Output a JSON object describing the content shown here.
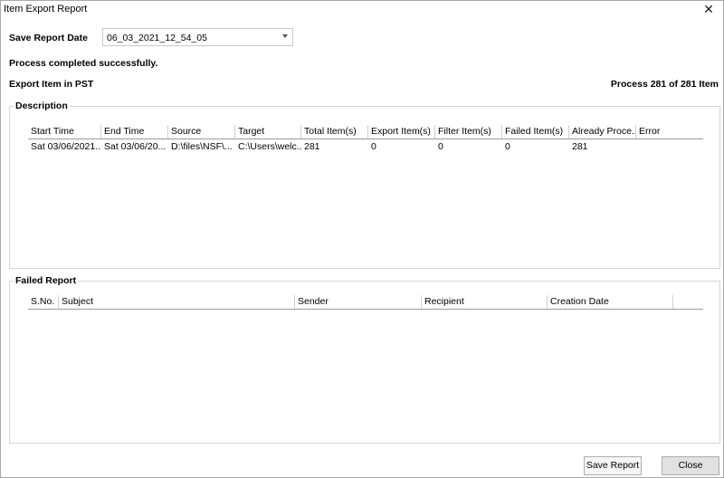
{
  "window": {
    "title": "Item Export Report",
    "close_glyph": "✕"
  },
  "header": {
    "save_report_date_label": "Save Report Date",
    "save_report_date_value": "06_03_2021_12_54_05",
    "status_message": "Process completed successfully.",
    "export_label": "Export Item in PST",
    "progress_text": "Process 281 of 281 Item"
  },
  "description": {
    "title": "Description",
    "columns": [
      "Start Time",
      "End Time",
      "Source",
      "Target",
      "Total Item(s)",
      "Export Item(s)",
      "Filter Item(s)",
      "Failed Item(s)",
      "Already Proce...",
      "Error"
    ],
    "rows": [
      [
        "Sat 03/06/2021...",
        "Sat 03/06/20...",
        "D:\\files\\NSF\\...",
        "C:\\Users\\welc...",
        "281",
        "0",
        "0",
        "0",
        "281",
        ""
      ]
    ]
  },
  "failed_report": {
    "title": "Failed Report",
    "columns": [
      "S.No.",
      "Subject",
      "Sender",
      "Recipient",
      "Creation Date"
    ]
  },
  "footer": {
    "save_report_label": "Save Report",
    "close_label": "Close"
  },
  "icons": {
    "close": "close-icon",
    "dropdown": "chevron-down-icon"
  }
}
